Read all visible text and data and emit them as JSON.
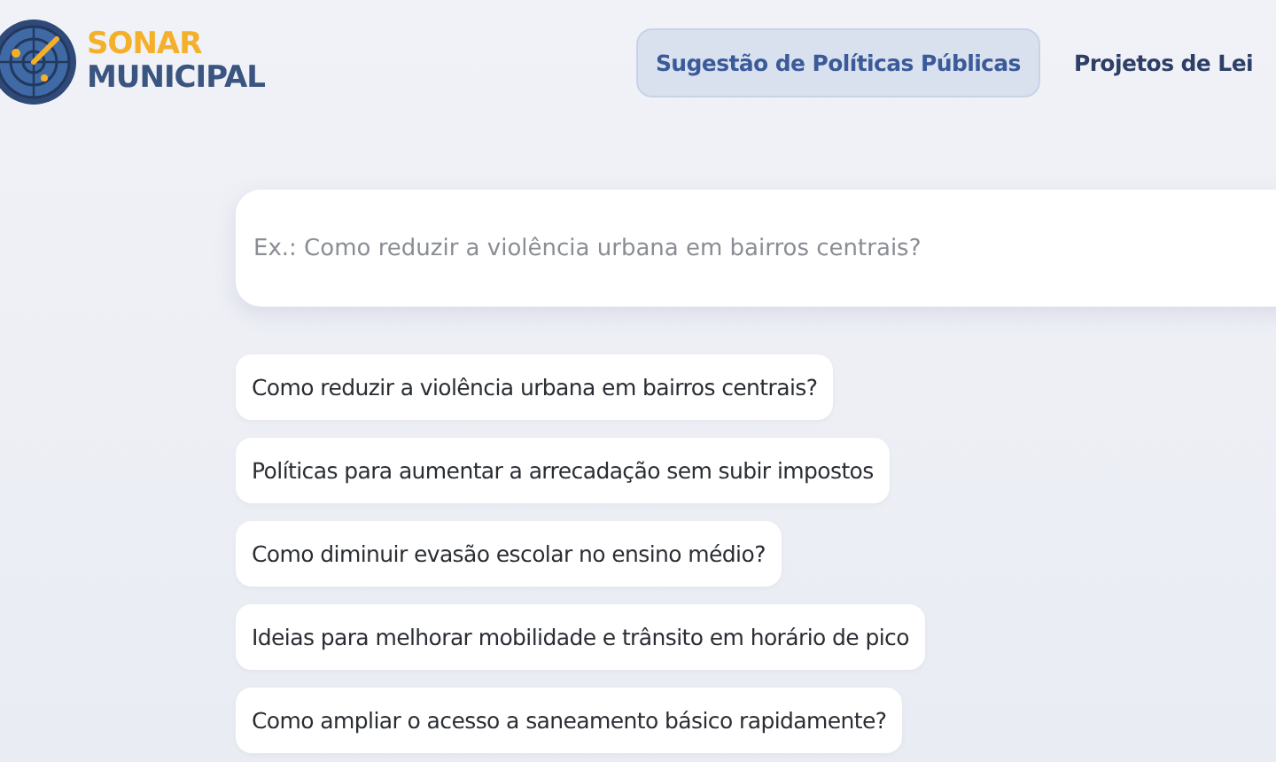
{
  "logo": {
    "line_1": "SONAR",
    "line_2": "MUNICIPAL"
  },
  "nav": [
    {
      "label": "Sugestão de Políticas Públicas",
      "selected": true
    },
    {
      "label": "Projetos de Lei",
      "selected": false
    }
  ],
  "search": {
    "placeholder": "Ex.: Como reduzir a violência urbana em bairros centrais?"
  },
  "suggestions": [
    "Como reduzir a violência urbana em bairros centrais?",
    "Políticas para aumentar a arrecadação sem subir impostos",
    "Como diminuir evasão escolar no ensino médio?",
    "Ideias para melhorar mobilidade e trânsito em horário de pico",
    "Como ampliar o acesso a saneamento básico rapidamente?"
  ]
}
